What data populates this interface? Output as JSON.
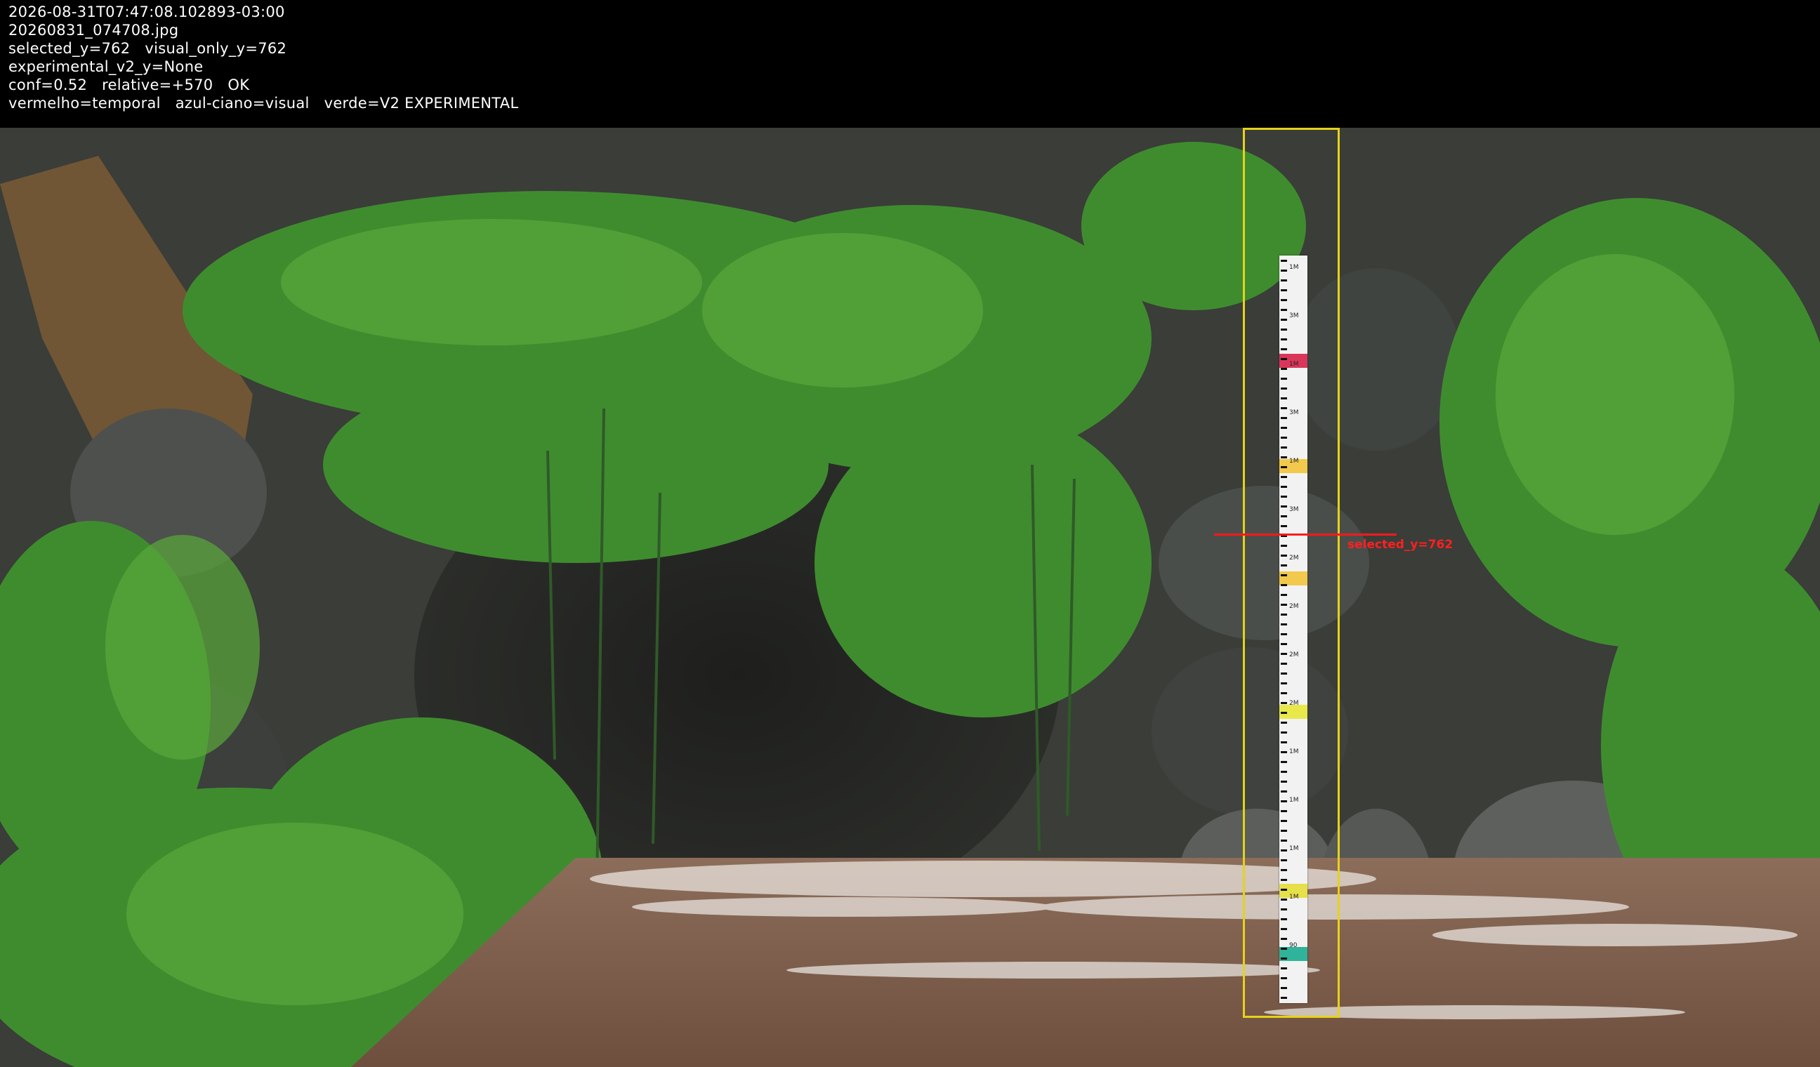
{
  "overlay": {
    "lines": [
      "2026-08-31T07:47:08.102893-03:00",
      "20260831_074708.jpg",
      "selected_y=762   visual_only_y=762",
      "experimental_v2_y=None",
      "conf=0.52   relative=+570   OK",
      "vermelho=temporal   azul-ciano=visual   verde=V2 EXPERIMENTAL"
    ]
  },
  "annotation": {
    "level_label": "selected_y=762"
  },
  "staff_gauge": {
    "marks": [
      "1M",
      "3M",
      "1M",
      "3M",
      "1M",
      "3M",
      "2M",
      "2M",
      "2M",
      "2M",
      "1M",
      "1M",
      "1M",
      "1M",
      "90"
    ],
    "band_colors": [
      "#d9365a",
      "#f2c94c",
      "#f2c94c",
      "#e8e84a",
      "#e6e04a",
      "#2fb39a"
    ]
  },
  "colors": {
    "roi_box": "#e6d21a",
    "level_line": "#ff1a1a",
    "water": "#7a5a48",
    "foliage": "#3e8a2e"
  }
}
